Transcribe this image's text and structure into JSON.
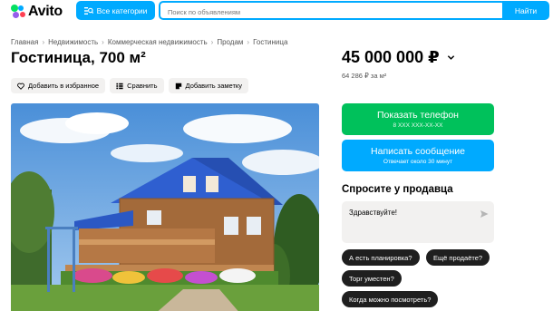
{
  "header": {
    "logo_text": "Avito",
    "categories_label": "Все категории",
    "search_placeholder": "Поиск по объявлениям",
    "find_label": "Найти"
  },
  "breadcrumbs": [
    "Главная",
    "Недвижимость",
    "Коммерческая недвижимость",
    "Продам",
    "Гостиница"
  ],
  "listing": {
    "title": "Гостиница, 700 м²",
    "actions": {
      "favorite": "Добавить в избранное",
      "compare": "Сравнить",
      "note": "Добавить заметку"
    }
  },
  "sidebar": {
    "price": "45 000 000 ₽",
    "price_per_m2": "64 286 ₽ за м²",
    "phone_button": {
      "label": "Показать телефон",
      "sub": "8 XXX XXX-XX-XX"
    },
    "message_button": {
      "label": "Написать сообщение",
      "sub": "Отвечает около 30 минут"
    },
    "ask_title": "Спросите у продавца",
    "ask_text": "Здравствуйте!",
    "quick_questions": [
      "А есть планировка?",
      "Ещё продаёте?",
      "Торг уместен?",
      "Когда можно посмотреть?"
    ]
  },
  "colors": {
    "brand_blue": "#00aaff",
    "phone_green": "#00c15b",
    "chip_dark": "#1f1f1f"
  }
}
